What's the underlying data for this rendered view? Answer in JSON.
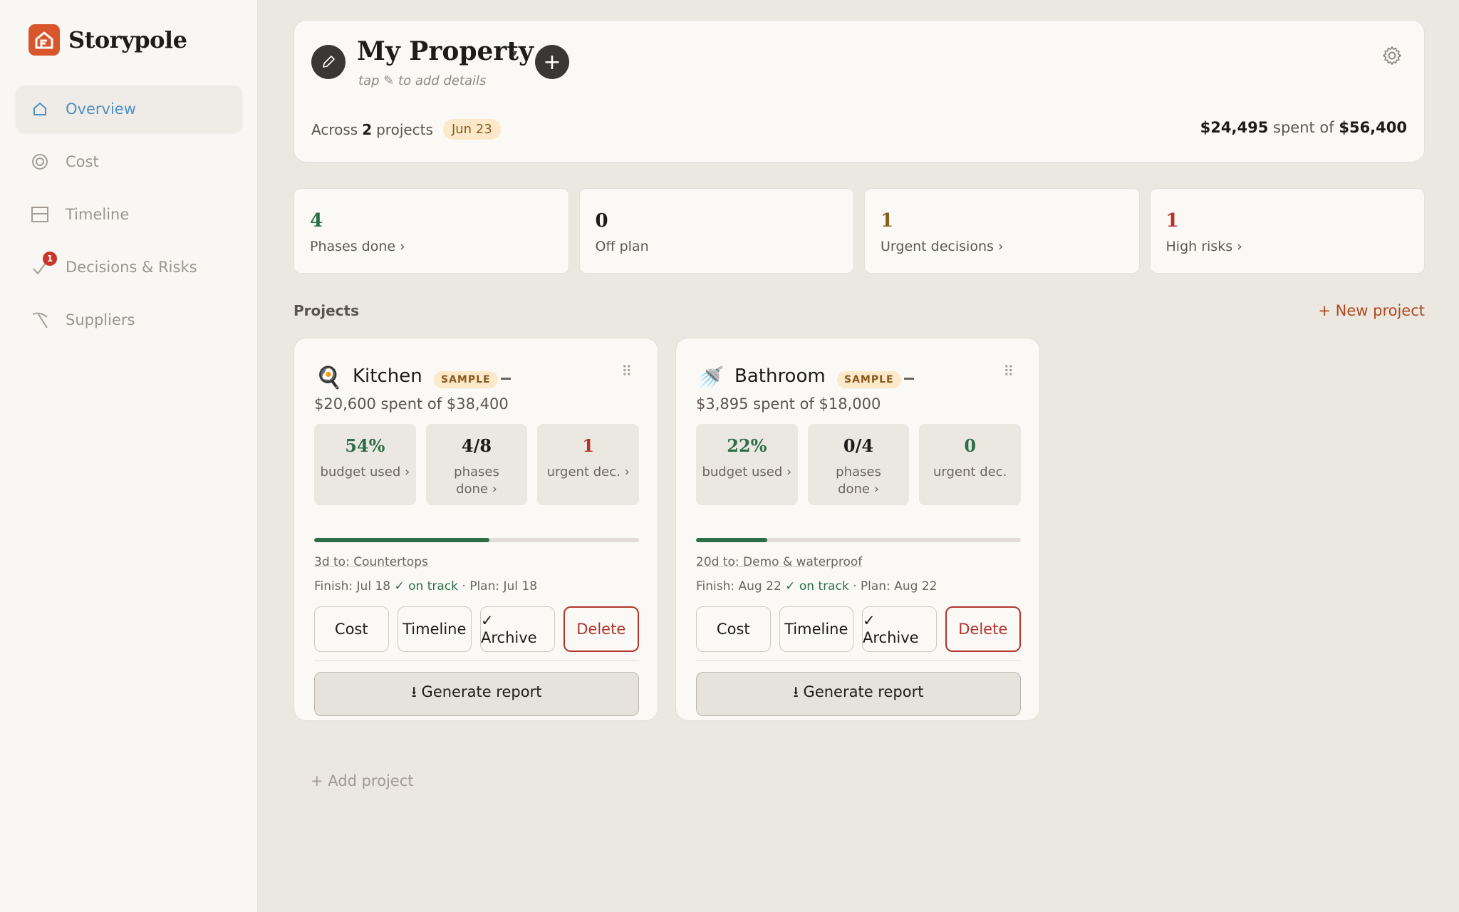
{
  "app": {
    "name": "Storypole"
  },
  "sidebar": {
    "items": [
      {
        "label": "Overview",
        "icon": "home-icon",
        "active": true
      },
      {
        "label": "Cost",
        "icon": "coin-icon"
      },
      {
        "label": "Timeline",
        "icon": "calendar-icon"
      },
      {
        "label": "Decisions & Risks",
        "icon": "checkmark-icon",
        "badge": "1"
      },
      {
        "label": "Suppliers",
        "icon": "pickaxe-icon"
      }
    ]
  },
  "property": {
    "title": "My Property",
    "caret": "▾",
    "subtitle": "tap ✎ to add details",
    "across_prefix": "Across",
    "project_count": "2",
    "across_suffix": "projects",
    "date": "Jun 23",
    "spent": "$24,495",
    "spent_mid": "spent of",
    "budget": "$56,400"
  },
  "stats": [
    {
      "value": "4",
      "label": "Phases done ›",
      "color": "#2d6e48"
    },
    {
      "value": "0",
      "label": "Off plan",
      "color": "#1f1b18"
    },
    {
      "value": "1",
      "label": "Urgent decisions ›",
      "color": "#8a5a1a"
    },
    {
      "value": "1",
      "label": "High risks ›",
      "color": "#b2342a"
    }
  ],
  "projects_section": {
    "title": "Projects",
    "new_label": "+ New project",
    "add_label": "+ Add project"
  },
  "projects": [
    {
      "name": "Kitchen",
      "emoji": "🍳",
      "sample": "SAMPLE",
      "spent_line": "$20,600 spent of $38,400",
      "budget_pct": "54%",
      "budget_label": "budget used ›",
      "phases": "4/8",
      "phases_label": "phases done ›",
      "urgent": "1",
      "urgent_label": "urgent dec. ›",
      "progress": 0.54,
      "next": "3d to: Countertops",
      "finish": "Finish: Jul 18",
      "status": "✓ on track",
      "plan": "· Plan: Jul 18",
      "buttons": {
        "cost": "Cost",
        "timeline": "Timeline",
        "archive": "✓ Archive",
        "delete": "Delete"
      },
      "report": "⭳ Generate report"
    },
    {
      "name": "Bathroom",
      "emoji": "🚿",
      "sample": "SAMPLE",
      "spent_line": "$3,895 spent of $18,000",
      "budget_pct": "22%",
      "budget_label": "budget used ›",
      "phases": "0/4",
      "phases_label": "phases done ›",
      "urgent": "0",
      "urgent_label": "urgent dec.",
      "progress": 0.22,
      "next": "20d to: Demo & waterproof",
      "finish": "Finish: Aug 22",
      "status": "✓ on track",
      "plan": "· Plan: Aug 22",
      "buttons": {
        "cost": "Cost",
        "timeline": "Timeline",
        "archive": "✓ Archive",
        "delete": "Delete"
      },
      "report": "⭳ Generate report"
    }
  ]
}
